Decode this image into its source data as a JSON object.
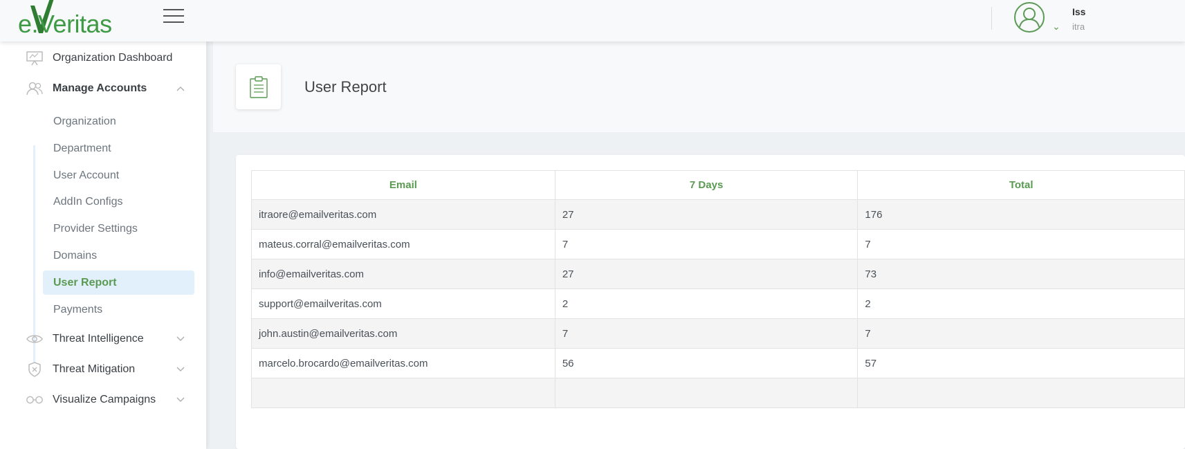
{
  "app": {
    "logo_text": "e.Veritas",
    "user_name": "Iss",
    "user_sub": "itra"
  },
  "sidebar": {
    "items": [
      {
        "label": "Organization Dashboard",
        "icon": "presentation-board-icon"
      },
      {
        "label": "Manage Accounts",
        "icon": "users-icon"
      },
      {
        "label": "Threat Intelligence",
        "icon": "eye-icon"
      },
      {
        "label": "Threat Mitigation",
        "icon": "shield-icon"
      },
      {
        "label": "Visualize Campaigns",
        "icon": "glasses-icon"
      }
    ],
    "sub_items": [
      {
        "label": "Organization"
      },
      {
        "label": "Department"
      },
      {
        "label": "User Account"
      },
      {
        "label": "AddIn Configs"
      },
      {
        "label": "Provider Settings"
      },
      {
        "label": "Domains"
      },
      {
        "label": "User Report"
      },
      {
        "label": "Payments"
      }
    ]
  },
  "page": {
    "title": "User Report"
  },
  "table": {
    "headers": [
      "Email",
      "7 Days",
      "Total"
    ],
    "rows": [
      [
        "itraore@emailveritas.com",
        "27",
        "176"
      ],
      [
        "mateus.corral@emailveritas.com",
        "7",
        "7"
      ],
      [
        "info@emailveritas.com",
        "27",
        "73"
      ],
      [
        "support@emailveritas.com",
        "2",
        "2"
      ],
      [
        "john.austin@emailveritas.com",
        "7",
        "7"
      ],
      [
        "marcelo.brocardo@emailveritas.com",
        "56",
        "57"
      ],
      [
        "",
        "",
        ""
      ]
    ]
  },
  "colors": {
    "accent": "#5a9a52",
    "active_bg": "#e2f0fb"
  }
}
